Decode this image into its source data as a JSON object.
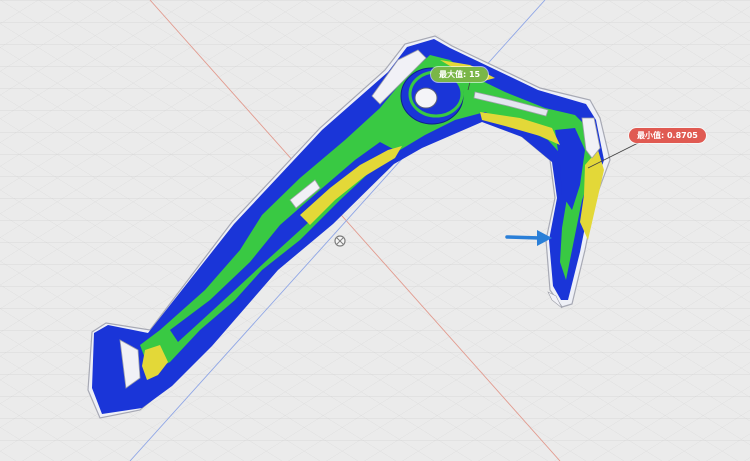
{
  "callouts": {
    "max": {
      "label": "最大值: 15",
      "color": "#7ab648"
    },
    "min": {
      "label": "最小值: 0.8705",
      "color": "#e05a52"
    }
  },
  "colors": {
    "background": "#ebebeb",
    "grid": "#d2d2d2",
    "axis_red": "#e29b8f",
    "axis_blue": "#8fa6e6",
    "part_blue": "#1a35d8",
    "part_green": "#39c943",
    "part_yellow": "#e3d838",
    "load_arrow": "#2a7fd8"
  },
  "icons": {
    "origin": "origin-marker-icon",
    "load": "load-arrow-icon"
  }
}
